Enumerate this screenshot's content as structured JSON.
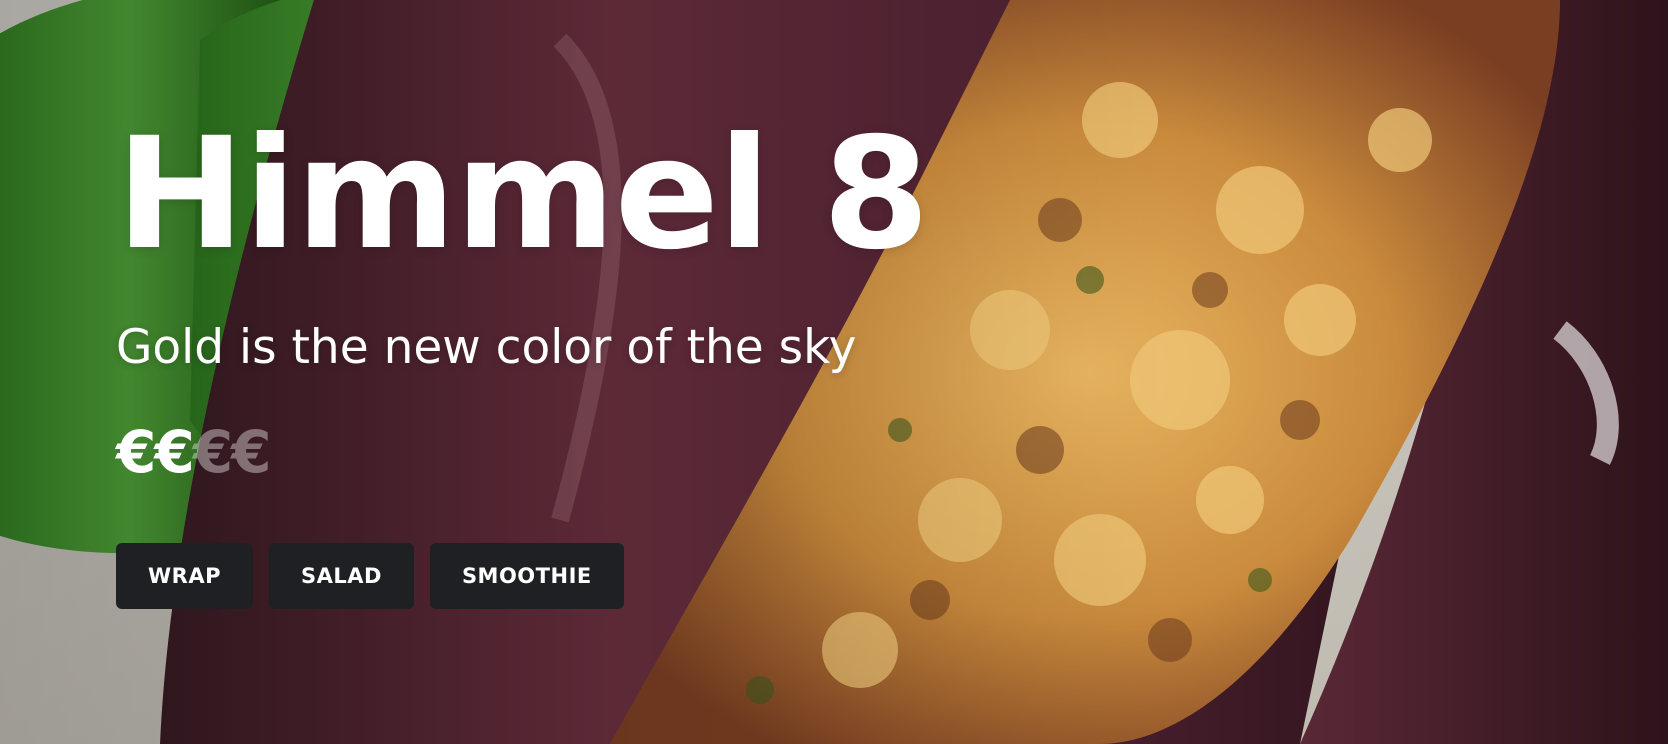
{
  "hero": {
    "title": "Himmel 8",
    "subtitle": "Gold is the new color of the sky",
    "price": {
      "symbol": "€",
      "level": 2,
      "max": 4,
      "active": "€€",
      "inactive": "€€"
    },
    "tags": [
      {
        "label": "WRAP"
      },
      {
        "label": "SALAD"
      },
      {
        "label": "SMOOTHIE"
      }
    ],
    "image_icon": "food-photo"
  },
  "colors": {
    "tag_background": "#1f2023",
    "text": "#ffffff"
  }
}
